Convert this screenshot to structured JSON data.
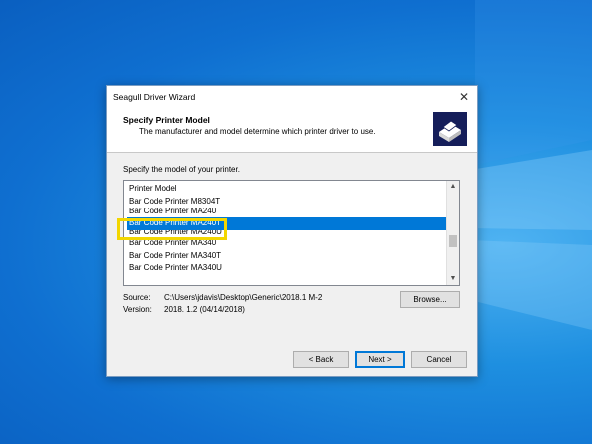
{
  "dialog": {
    "title": "Seagull Driver Wizard",
    "close_glyph": "✕",
    "header_title": "Specify Printer Model",
    "header_subtitle": "The manufacturer and model determine which printer driver to use.",
    "prompt": "Specify the model of your printer.",
    "list_header": "Printer Model",
    "items": [
      {
        "label": "Bar Code Printer M8304T",
        "selected": false
      },
      {
        "label": "Bar Code Printer MA240",
        "selected": false
      },
      {
        "label": "Bar Code Printer MA240T",
        "selected": true
      },
      {
        "label": "Bar Code Printer MA240U",
        "selected": false
      },
      {
        "label": "Bar Code Printer MA340",
        "selected": false
      },
      {
        "label": "Bar Code Printer MA340T",
        "selected": false
      },
      {
        "label": "Bar Code Printer MA340U",
        "selected": false
      }
    ],
    "source_label": "Source:",
    "source_value": "C:\\Users\\jdavis\\Desktop\\Generic\\2018.1 M-2",
    "version_label": "Version:",
    "version_value": "2018. 1.2 (04/14/2018)",
    "browse_label": "Browse...",
    "back_label": "< Back",
    "next_label": "Next >",
    "cancel_label": "Cancel"
  },
  "icons": {
    "close": "close-icon",
    "printer": "printer-icon",
    "scroll_up": "▲",
    "scroll_down": "▼"
  },
  "colors": {
    "accent": "#0078d7",
    "highlight": "#f2d600",
    "icon_bg": "#151e5a"
  }
}
